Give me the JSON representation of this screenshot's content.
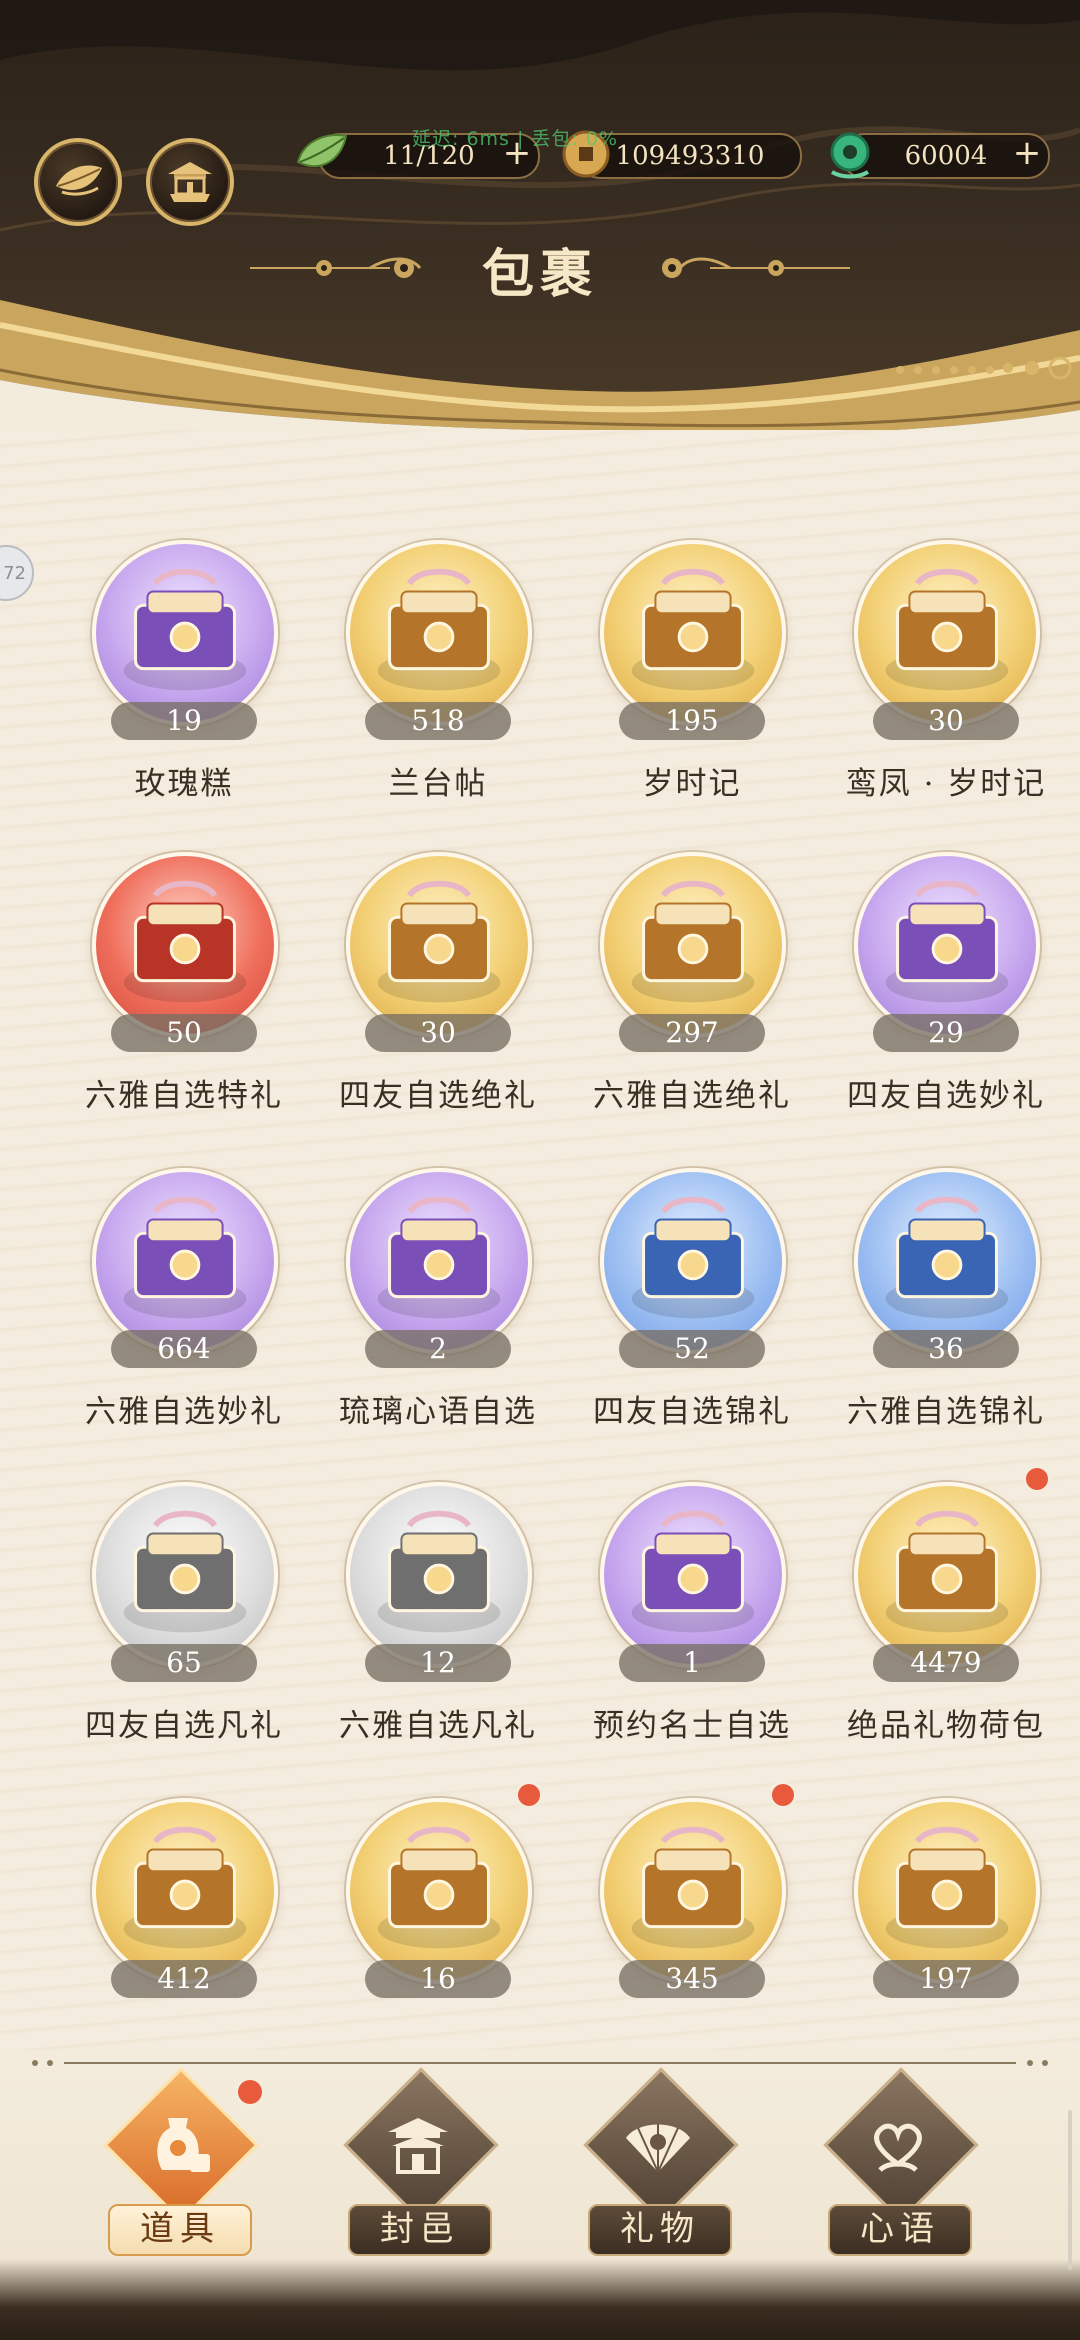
{
  "header": {
    "title": "包裹",
    "net_status": "延迟: 6ms | 丢包: 0%",
    "buttons": [
      {
        "name": "leaf-menu-button",
        "icon": "leaf-emblem-icon"
      },
      {
        "name": "pavilion-button",
        "icon": "pavilion-icon"
      }
    ],
    "resources": [
      {
        "name": "stamina",
        "icon": "green-leaf-icon",
        "value": "11/120",
        "has_plus": true
      },
      {
        "name": "coins",
        "icon": "copper-coin-icon",
        "value": "109493310",
        "has_plus": false
      },
      {
        "name": "jade",
        "icon": "jade-pendant-icon",
        "value": "60004",
        "has_plus": true
      }
    ],
    "plus_symbol": "+"
  },
  "side_tab_label": "72",
  "items": [
    {
      "name": "玫瑰糕",
      "count": "19",
      "bg": "purple",
      "icon": "rose-cake-icon",
      "badge": false
    },
    {
      "name": "兰台帖",
      "count": "518",
      "bg": "gold",
      "icon": "lantai-invitation-icon",
      "badge": false
    },
    {
      "name": "岁时记",
      "count": "195",
      "bg": "gold",
      "icon": "suishiji-scroll-icon",
      "badge": false
    },
    {
      "name": "鸾凤 · 岁时记",
      "count": "30",
      "bg": "gold",
      "icon": "phoenix-scroll-icon",
      "badge": false
    },
    {
      "name": "六雅自选特礼",
      "count": "50",
      "bg": "red",
      "icon": "pouch-icon",
      "badge": false
    },
    {
      "name": "四友自选绝礼",
      "count": "30",
      "bg": "gold",
      "icon": "gift-box-icon",
      "badge": false
    },
    {
      "name": "六雅自选绝礼",
      "count": "297",
      "bg": "gold",
      "icon": "crystal-box-icon",
      "badge": false
    },
    {
      "name": "四友自选妙礼",
      "count": "29",
      "bg": "purple",
      "icon": "gift-box-icon",
      "badge": false
    },
    {
      "name": "六雅自选妙礼",
      "count": "664",
      "bg": "purple",
      "icon": "food-box-icon",
      "badge": false
    },
    {
      "name": "琉璃心语自选",
      "count": "2",
      "bg": "purple",
      "icon": "crystal-chest-icon",
      "badge": false
    },
    {
      "name": "四友自选锦礼",
      "count": "52",
      "bg": "blue",
      "icon": "gift-box-icon",
      "badge": false
    },
    {
      "name": "六雅自选锦礼",
      "count": "36",
      "bg": "blue",
      "icon": "flower-box-icon",
      "badge": false
    },
    {
      "name": "四友自选凡礼",
      "count": "65",
      "bg": "grey",
      "icon": "gift-box-icon",
      "badge": false
    },
    {
      "name": "六雅自选凡礼",
      "count": "12",
      "bg": "grey",
      "icon": "pouch-icon",
      "badge": false
    },
    {
      "name": "预约名士自选",
      "count": "1",
      "bg": "purple",
      "icon": "book-fan-icon",
      "badge": false
    },
    {
      "name": "绝品礼物荷包",
      "count": "4479",
      "bg": "gold",
      "icon": "lady-figure-icon",
      "badge": true
    },
    {
      "name": "",
      "count": "412",
      "bg": "gold",
      "icon": "gift-box-icon",
      "badge": false
    },
    {
      "name": "",
      "count": "16",
      "bg": "gold",
      "icon": "purple-pouch-icon",
      "badge": true
    },
    {
      "name": "",
      "count": "345",
      "bg": "gold",
      "icon": "lady-figure-icon",
      "badge": true
    },
    {
      "name": "",
      "count": "197",
      "bg": "gold",
      "icon": "gift-box-icon",
      "badge": false
    }
  ],
  "nav": [
    {
      "label": "道具",
      "icon": "vase-icon",
      "active": true,
      "badge": true
    },
    {
      "label": "封邑",
      "icon": "palace-icon",
      "active": false,
      "badge": false
    },
    {
      "label": "礼物",
      "icon": "fan-icon",
      "active": false,
      "badge": false
    },
    {
      "label": "心语",
      "icon": "heart-knot-icon",
      "active": false,
      "badge": false
    }
  ],
  "colors": {
    "header_dark": "#2a2118",
    "gold_accent": "#d9b56a",
    "parchment": "#f4ecde",
    "badge_red": "#e85a3c",
    "active_nav": "#e88a3c"
  }
}
